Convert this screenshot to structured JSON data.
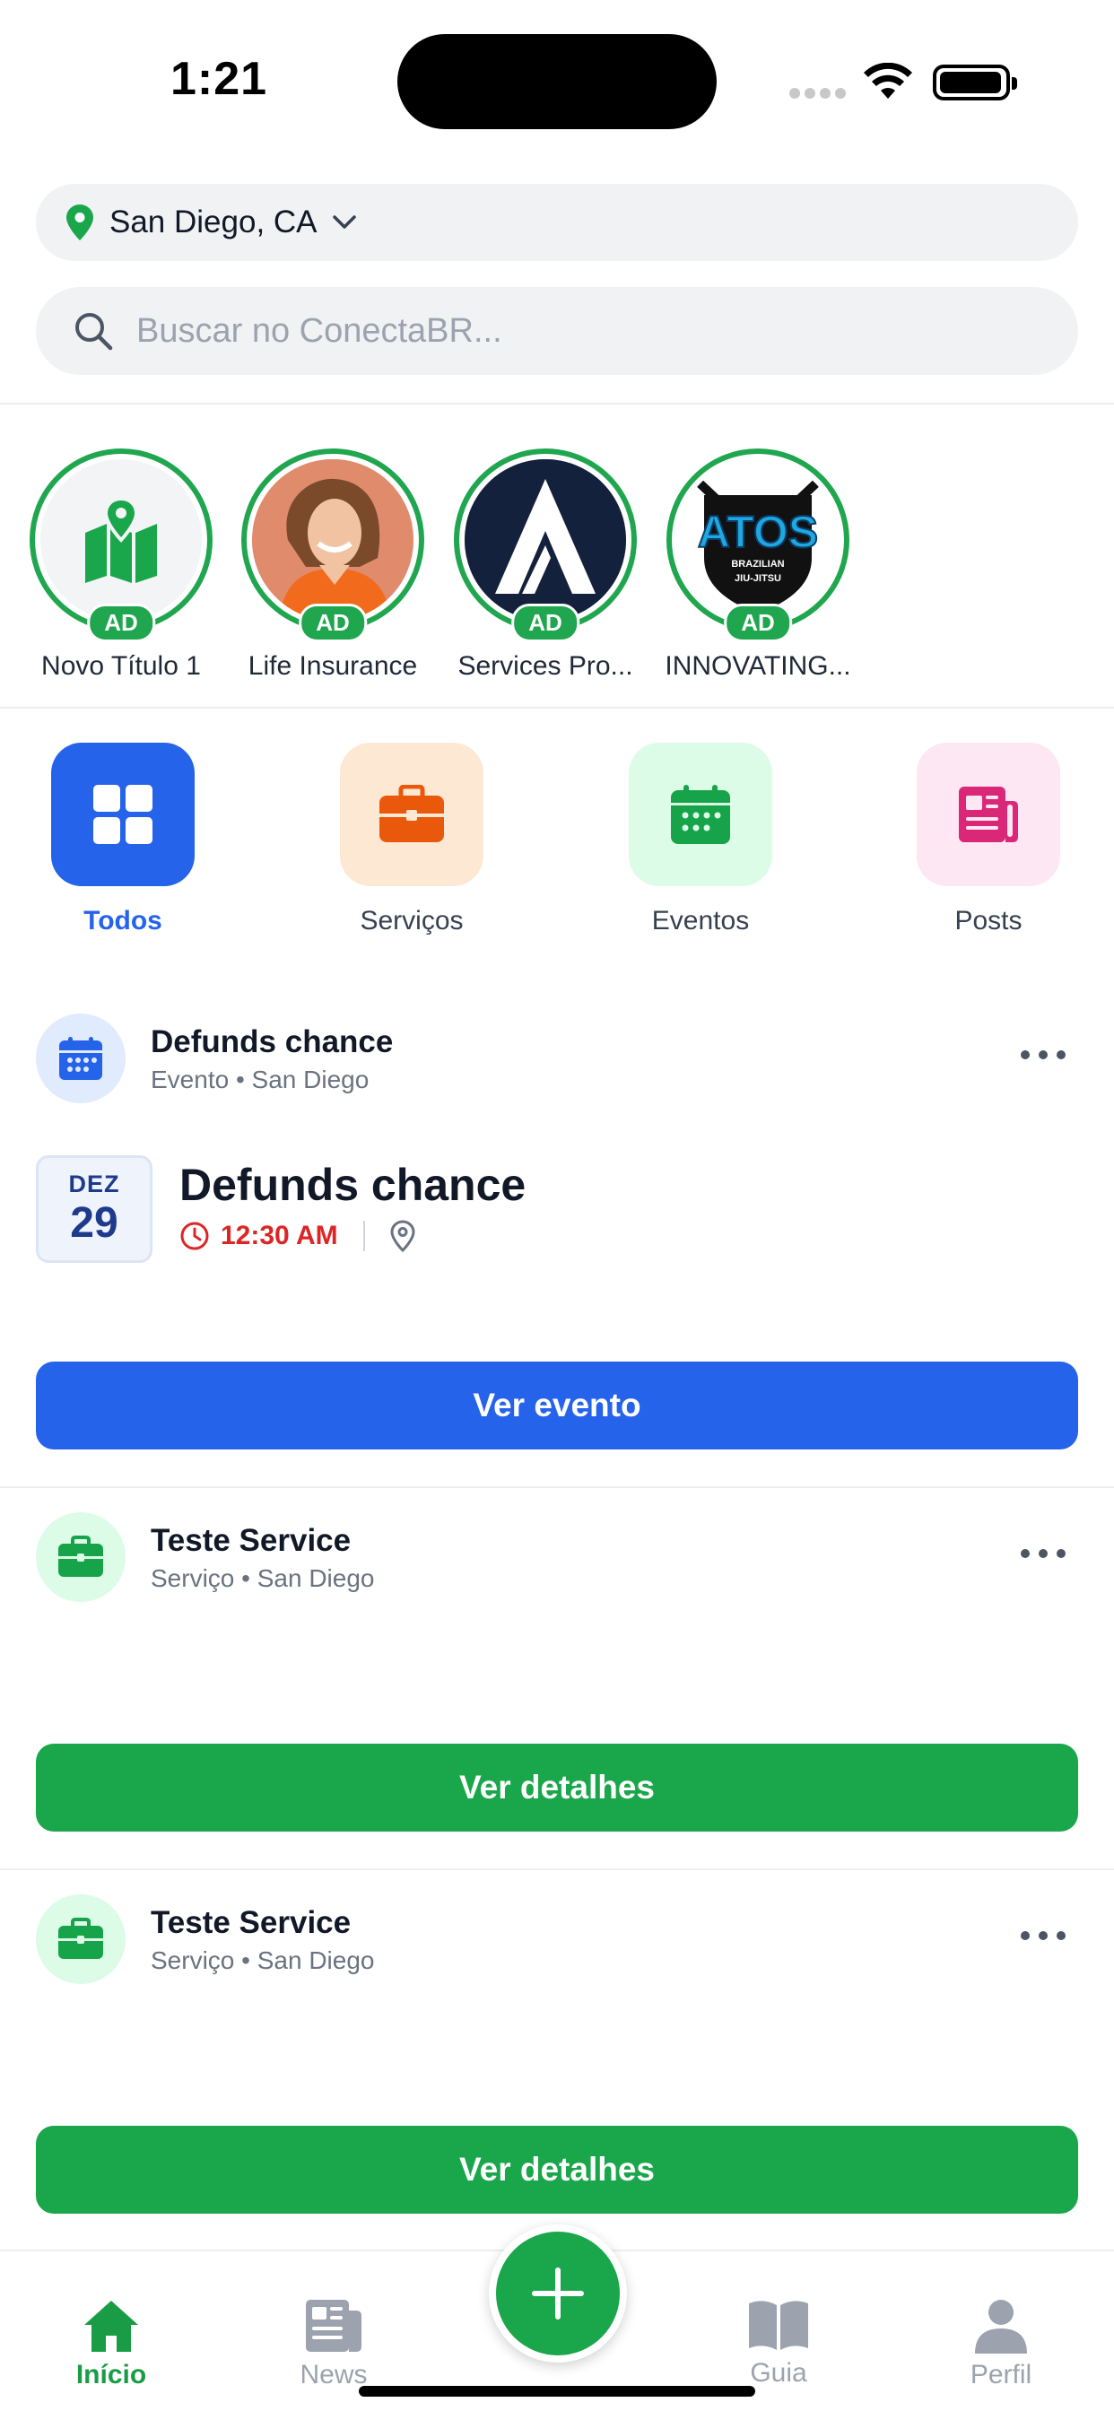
{
  "status_bar": {
    "time": "1:21"
  },
  "location": {
    "label": "San Diego, CA"
  },
  "search": {
    "placeholder": "Buscar no ConectaBR..."
  },
  "stories": [
    {
      "label": "Novo Título 1",
      "badge": "AD"
    },
    {
      "label": "Life Insurance",
      "badge": "AD"
    },
    {
      "label": "Services Pro...",
      "badge": "AD"
    },
    {
      "label": "INNOVATING...",
      "badge": "AD"
    }
  ],
  "atos_logo": {
    "title": "ATOS",
    "sub1": "BRAZILIAN",
    "sub2": "JIU-JITSU"
  },
  "categories": [
    {
      "label": "Todos",
      "active": true
    },
    {
      "label": "Serviços",
      "active": false
    },
    {
      "label": "Eventos",
      "active": false
    },
    {
      "label": "Posts",
      "active": false
    }
  ],
  "feed": [
    {
      "title": "Defunds chance",
      "subtitle": "Evento • San Diego",
      "event": {
        "month": "DEZ",
        "day": "29",
        "title": "Defunds chance",
        "time": "12:30 AM"
      },
      "button": "Ver evento"
    },
    {
      "title": "Teste Service",
      "subtitle": "Serviço • San Diego",
      "button": "Ver detalhes"
    },
    {
      "title": "Teste Service",
      "subtitle": "Serviço • San Diego",
      "button": "Ver detalhes"
    }
  ],
  "bottom_nav": [
    {
      "label": "Início",
      "active": true
    },
    {
      "label": "News",
      "active": false
    },
    {
      "label": "Guia",
      "active": false
    },
    {
      "label": "Perfil",
      "active": false
    }
  ],
  "colors": {
    "primary_green": "#1aa64a",
    "primary_blue": "#2563eb",
    "event_red": "#dc2626"
  }
}
